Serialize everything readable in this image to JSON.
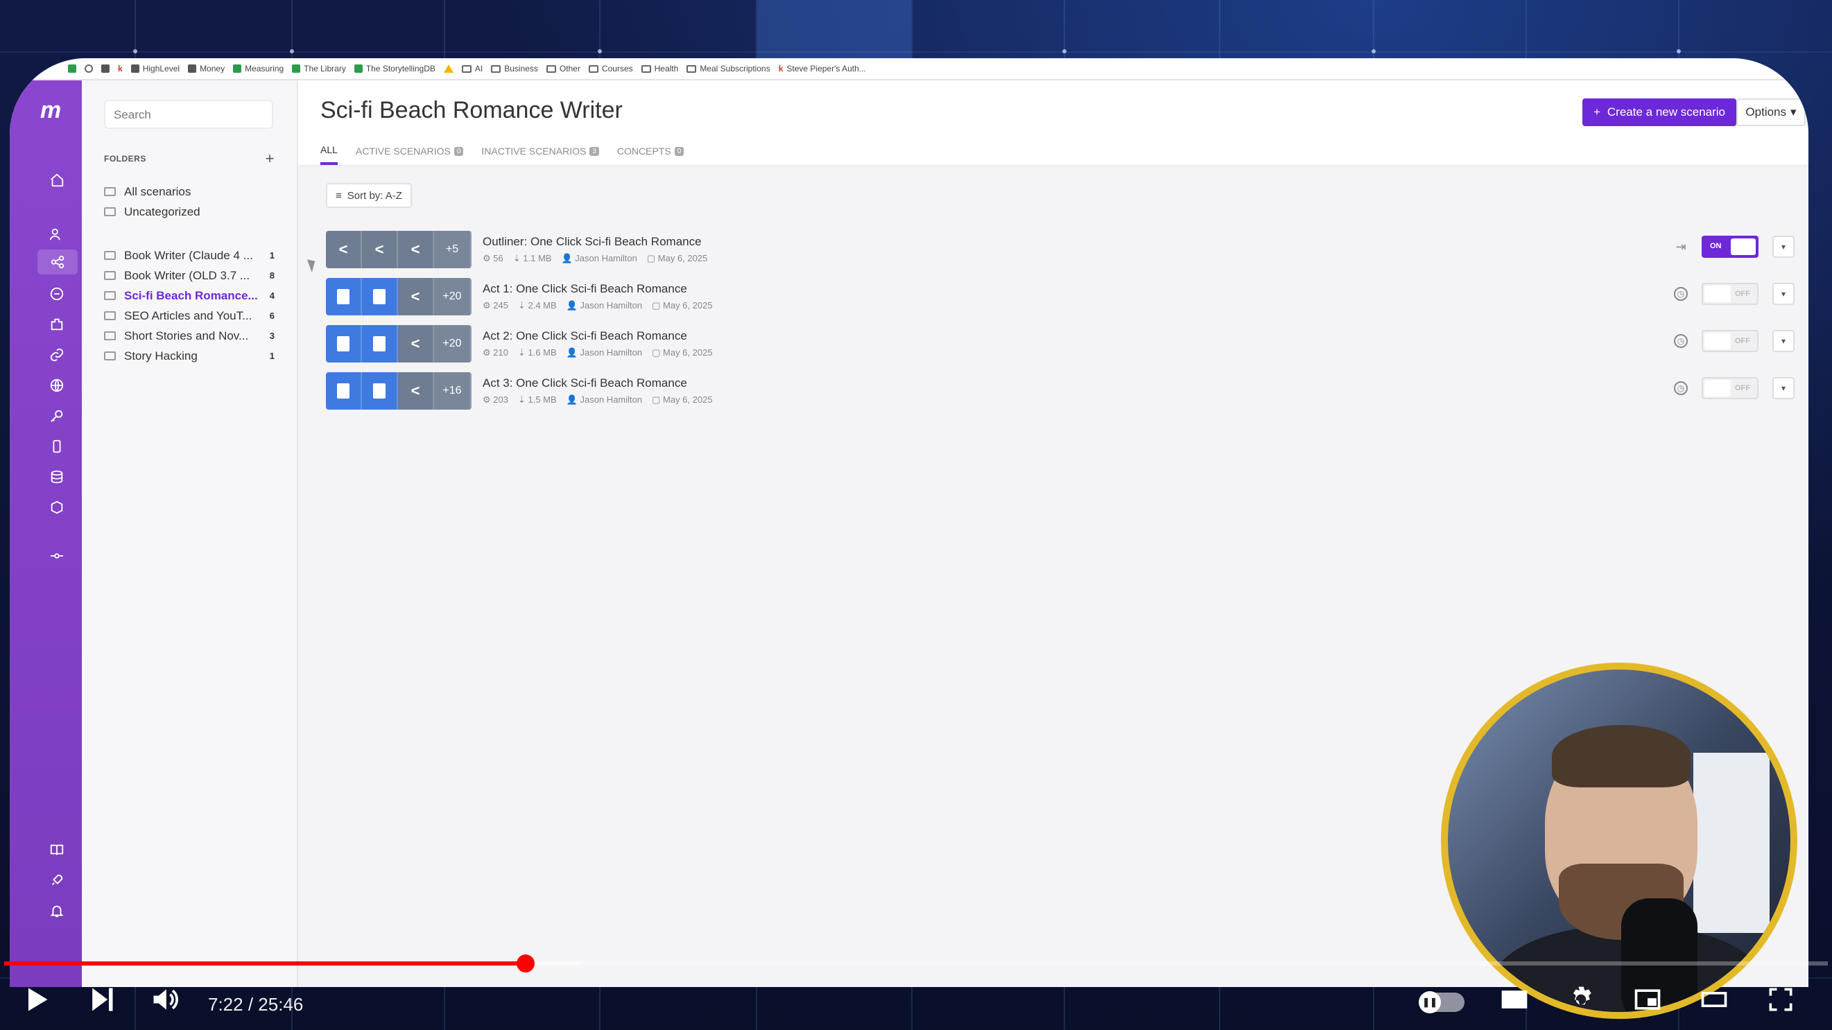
{
  "bookmarks": [
    {
      "icon": "green-square-icon",
      "label": ""
    },
    {
      "icon": "globe-icon",
      "label": ""
    },
    {
      "icon": "page-icon",
      "label": ""
    },
    {
      "icon": "red-logo-icon",
      "label": ""
    },
    {
      "icon": "page-icon",
      "label": "HighLevel"
    },
    {
      "icon": "page-icon",
      "label": "Money"
    },
    {
      "icon": "green-square-icon",
      "label": "Measuring"
    },
    {
      "icon": "green-square-icon",
      "label": "The Library"
    },
    {
      "icon": "green-square-icon",
      "label": "The StorytellingDB"
    },
    {
      "icon": "drive-icon",
      "label": ""
    },
    {
      "icon": "folder-icon",
      "label": "AI"
    },
    {
      "icon": "folder-icon",
      "label": "Business"
    },
    {
      "icon": "folder-icon",
      "label": "Other"
    },
    {
      "icon": "folder-icon",
      "label": "Courses"
    },
    {
      "icon": "folder-icon",
      "label": "Health"
    },
    {
      "icon": "folder-icon",
      "label": "Meal Subscriptions"
    },
    {
      "icon": "red-logo-icon",
      "label": "Steve Pieper's Auth..."
    }
  ],
  "sidebar": {
    "search_placeholder": "Search",
    "folders_heading": "FOLDERS",
    "add_label": "+",
    "top_items": [
      {
        "label": "All scenarios",
        "count": ""
      },
      {
        "label": "Uncategorized",
        "count": ""
      }
    ],
    "items": [
      {
        "label": "Book Writer (Claude 4 ...",
        "count": "1"
      },
      {
        "label": "Book Writer (OLD 3.7 ...",
        "count": "8"
      },
      {
        "label": "Sci-fi Beach Romance...",
        "count": "4"
      },
      {
        "label": "SEO Articles and YouT...",
        "count": "6"
      },
      {
        "label": "Short Stories and Nov...",
        "count": "3"
      },
      {
        "label": "Story Hacking",
        "count": "1"
      }
    ]
  },
  "main": {
    "title": "Sci-fi Beach Romance Writer",
    "create_label": "Create a new scenario",
    "options_label": "Options",
    "tabs": [
      {
        "label": "ALL",
        "count": ""
      },
      {
        "label": "ACTIVE SCENARIOS",
        "count": "0"
      },
      {
        "label": "INACTIVE SCENARIOS",
        "count": "3"
      },
      {
        "label": "CONCEPTS",
        "count": "0"
      }
    ],
    "sort_label": "Sort by: A-Z",
    "scenarios": [
      {
        "title": "Outliner: One Click Sci-fi Beach Romance",
        "ops": "56",
        "size": "1.1 MB",
        "author": "Jason Hamilton",
        "date": "May 6, 2025",
        "more": "+5",
        "state": "ON"
      },
      {
        "title": "Act 1: One Click Sci-fi Beach Romance",
        "ops": "245",
        "size": "2.4 MB",
        "author": "Jason Hamilton",
        "date": "May 6, 2025",
        "more": "+20",
        "state": "OFF"
      },
      {
        "title": "Act 2: One Click Sci-fi Beach Romance",
        "ops": "210",
        "size": "1.6 MB",
        "author": "Jason Hamilton",
        "date": "May 6, 2025",
        "more": "+20",
        "state": "OFF"
      },
      {
        "title": "Act 3: One Click Sci-fi Beach Romance",
        "ops": "203",
        "size": "1.5 MB",
        "author": "Jason Hamilton",
        "date": "May 6, 2025",
        "more": "+16",
        "state": "OFF"
      }
    ]
  },
  "player": {
    "time": "7:22 / 25:46",
    "progress": 0.286,
    "buffered": 0.316
  },
  "colors": {
    "accent": "#6d28d9",
    "rail": "#8a46cf",
    "progress": "#ff0000",
    "webcam_ring": "#e3b92a"
  }
}
